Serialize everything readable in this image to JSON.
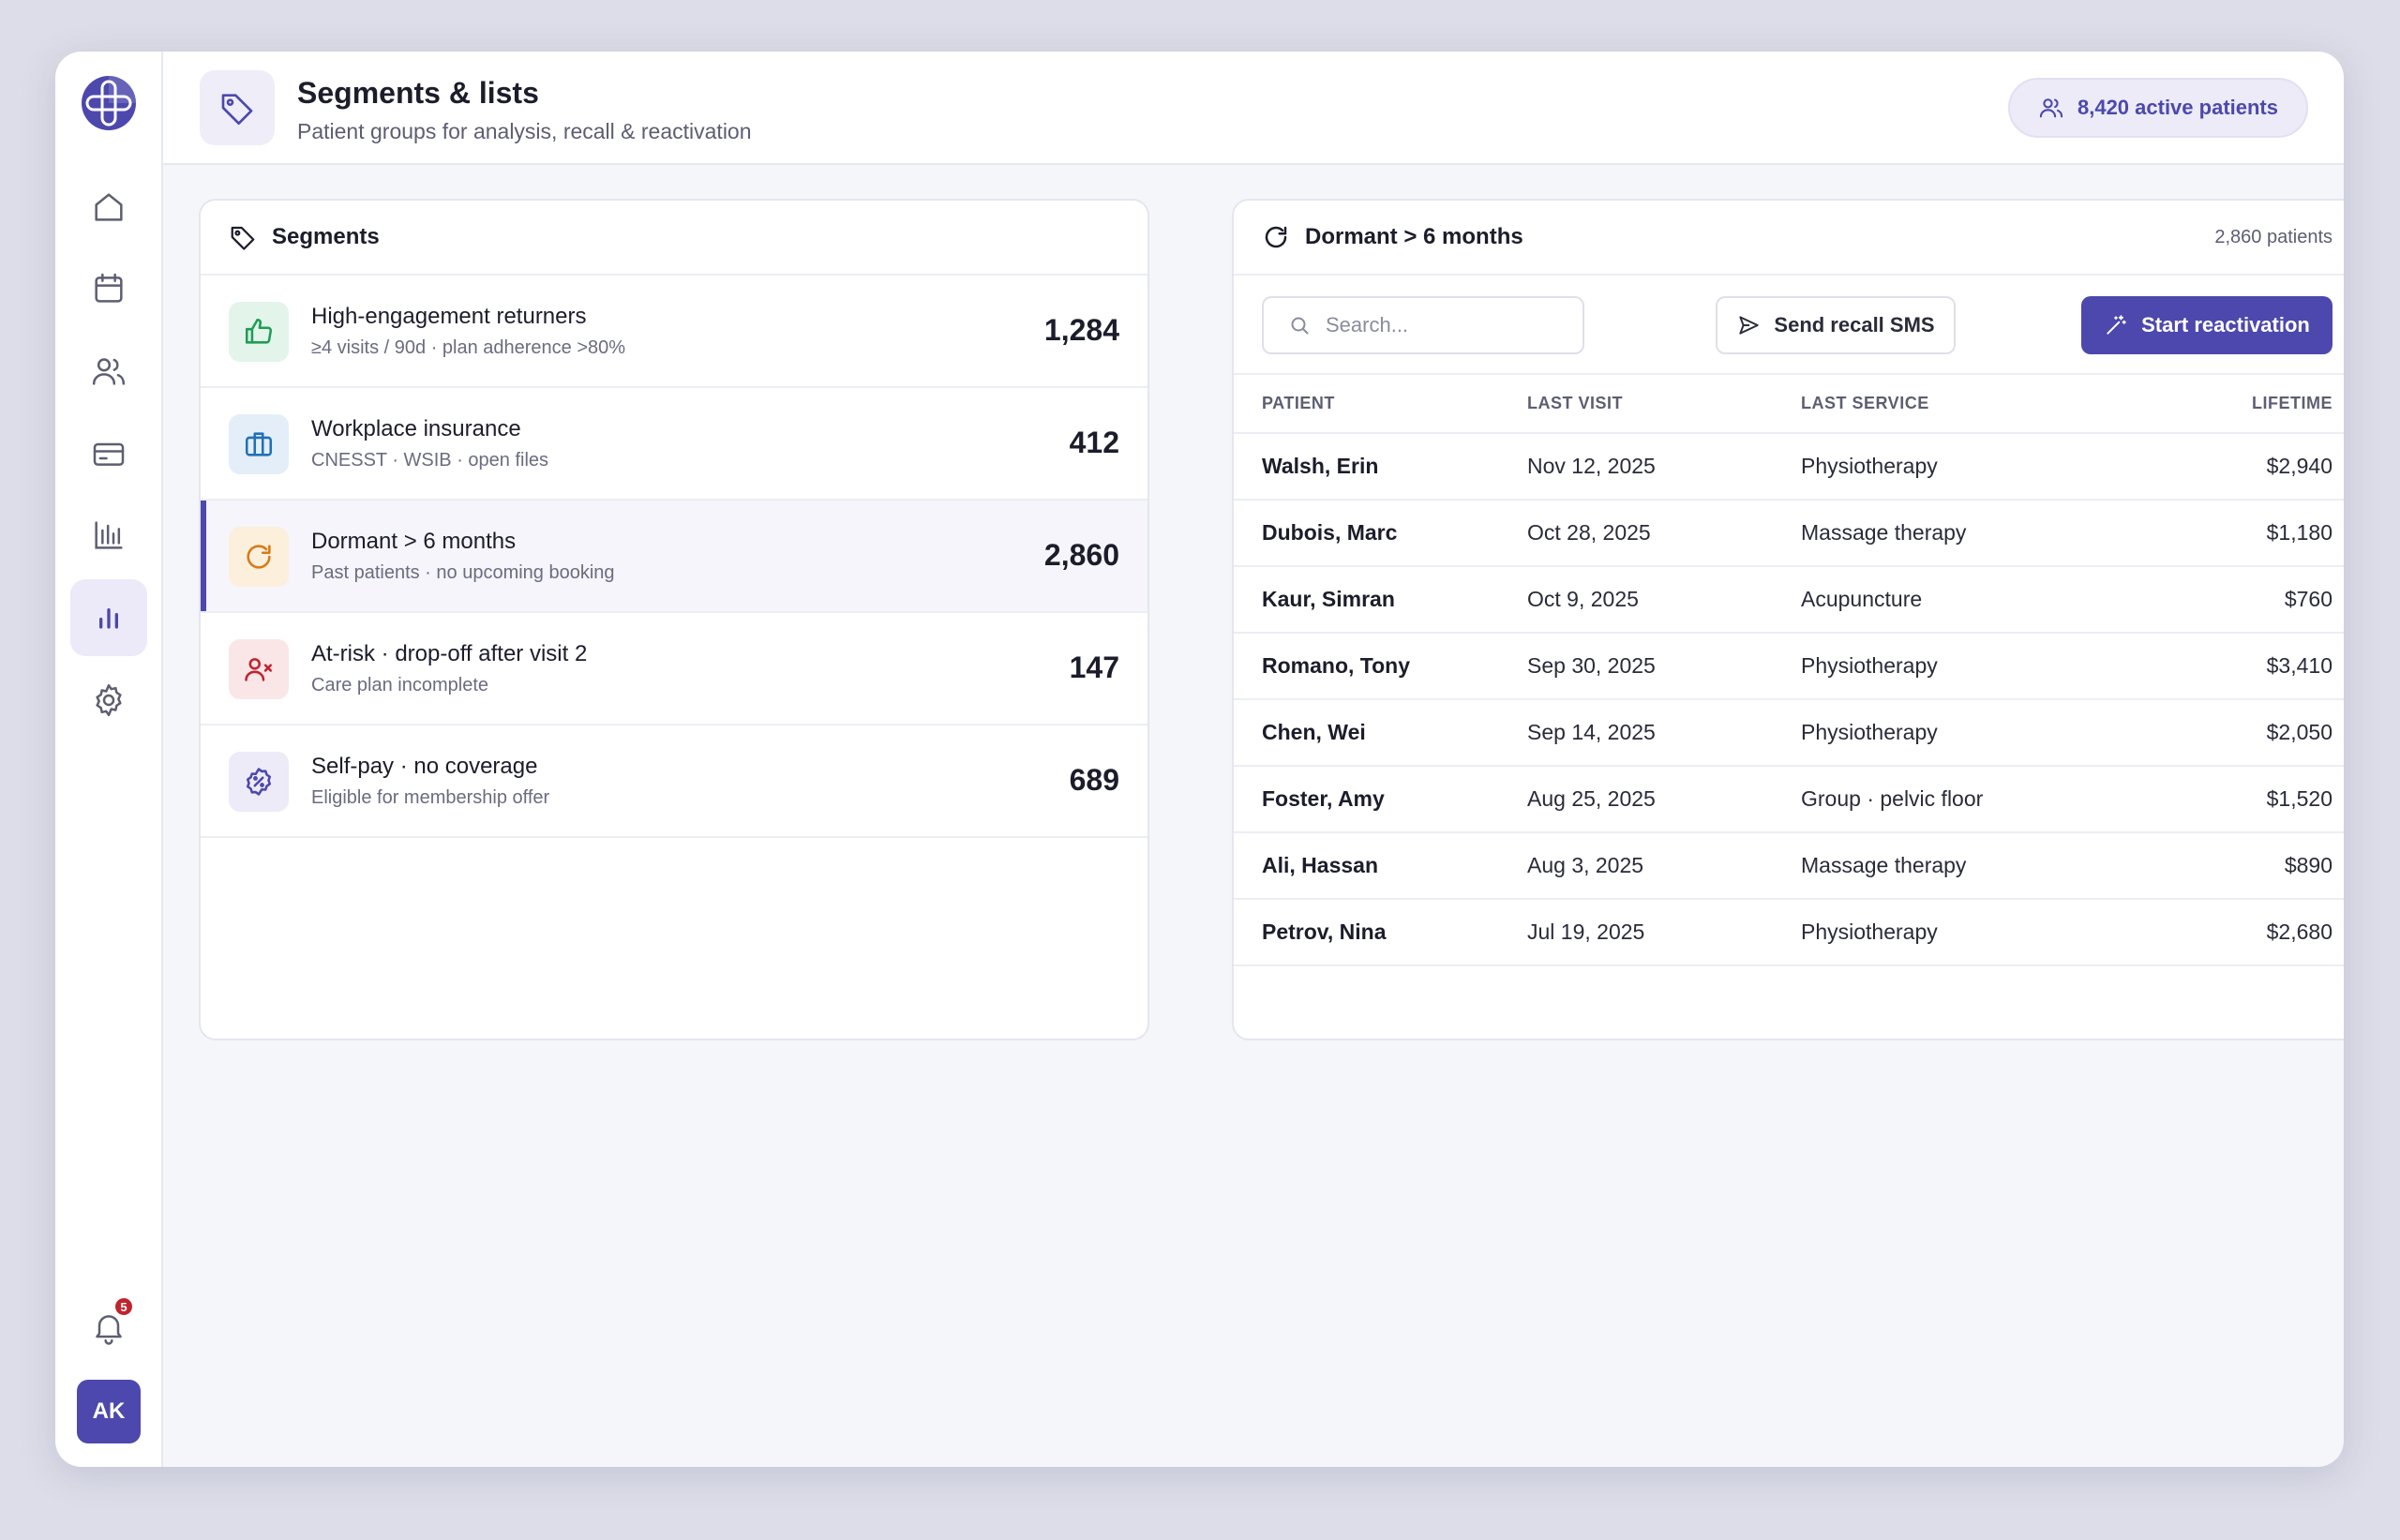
{
  "app": {
    "avatar_initials": "AK",
    "notification_count": "5"
  },
  "rail": {
    "items": [
      {
        "name": "home-icon",
        "active": false
      },
      {
        "name": "calendar-icon",
        "active": false
      },
      {
        "name": "patients-icon",
        "active": false
      },
      {
        "name": "billing-icon",
        "active": false
      },
      {
        "name": "reports-icon",
        "active": false
      },
      {
        "name": "segments-icon",
        "active": true
      },
      {
        "name": "gear-icon",
        "active": false
      }
    ]
  },
  "header": {
    "title": "Segments & lists",
    "subtitle": "Patient groups for analysis, recall & reactivation",
    "active_patients": "8,420 active patients"
  },
  "segments": {
    "title": "Segments",
    "items": [
      {
        "name": "High-engagement returners",
        "desc": "≥4 visits / 90d · plan adherence >80%",
        "count": "1,284",
        "icon": "thumbs-up-icon",
        "color": "#1f9d55",
        "bg": "#e3f5ea",
        "active": false
      },
      {
        "name": "Workplace insurance",
        "desc": "CNESST · WSIB · open files",
        "count": "412",
        "icon": "briefcase-icon",
        "color": "#2070b8",
        "bg": "#e3eef9",
        "active": false
      },
      {
        "name": "Dormant > 6 months",
        "desc": "Past patients · no upcoming booking",
        "count": "2,860",
        "icon": "refresh-icon",
        "color": "#d97917",
        "bg": "#fcefdc",
        "active": true
      },
      {
        "name": "At-risk · drop-off after visit 2",
        "desc": "Care plan incomplete",
        "count": "147",
        "icon": "user-x-icon",
        "color": "#c0242e",
        "bg": "#fbe6e7",
        "active": false
      },
      {
        "name": "Self-pay · no coverage",
        "desc": "Eligible for membership offer",
        "count": "689",
        "icon": "discount-badge-icon",
        "color": "#4d48ad",
        "bg": "#ecebf7",
        "active": false
      }
    ]
  },
  "detail": {
    "title": "Dormant > 6 months",
    "count": "2,860 patients",
    "search_placeholder": "Search...",
    "send_sms_label": "Send recall SMS",
    "start_label": "Start reactivation",
    "columns": [
      "PATIENT",
      "LAST VISIT",
      "LAST SERVICE",
      "LIFETIME"
    ],
    "rows": [
      {
        "patient": "Walsh, Erin",
        "last_visit": "Nov 12, 2025",
        "service": "Physiotherapy",
        "lifetime": "$2,940"
      },
      {
        "patient": "Dubois, Marc",
        "last_visit": "Oct 28, 2025",
        "service": "Massage therapy",
        "lifetime": "$1,180"
      },
      {
        "patient": "Kaur, Simran",
        "last_visit": "Oct 9, 2025",
        "service": "Acupuncture",
        "lifetime": "$760"
      },
      {
        "patient": "Romano, Tony",
        "last_visit": "Sep 30, 2025",
        "service": "Physiotherapy",
        "lifetime": "$3,410"
      },
      {
        "patient": "Chen, Wei",
        "last_visit": "Sep 14, 2025",
        "service": "Physiotherapy",
        "lifetime": "$2,050"
      },
      {
        "patient": "Foster, Amy",
        "last_visit": "Aug 25, 2025",
        "service": "Group · pelvic floor",
        "lifetime": "$1,520"
      },
      {
        "patient": "Ali, Hassan",
        "last_visit": "Aug 3, 2025",
        "service": "Massage therapy",
        "lifetime": "$890"
      },
      {
        "patient": "Petrov, Nina",
        "last_visit": "Jul 19, 2025",
        "service": "Physiotherapy",
        "lifetime": "$2,680"
      }
    ]
  },
  "colors": {
    "accent": "#4d48ad",
    "badge": "#c0242e"
  }
}
